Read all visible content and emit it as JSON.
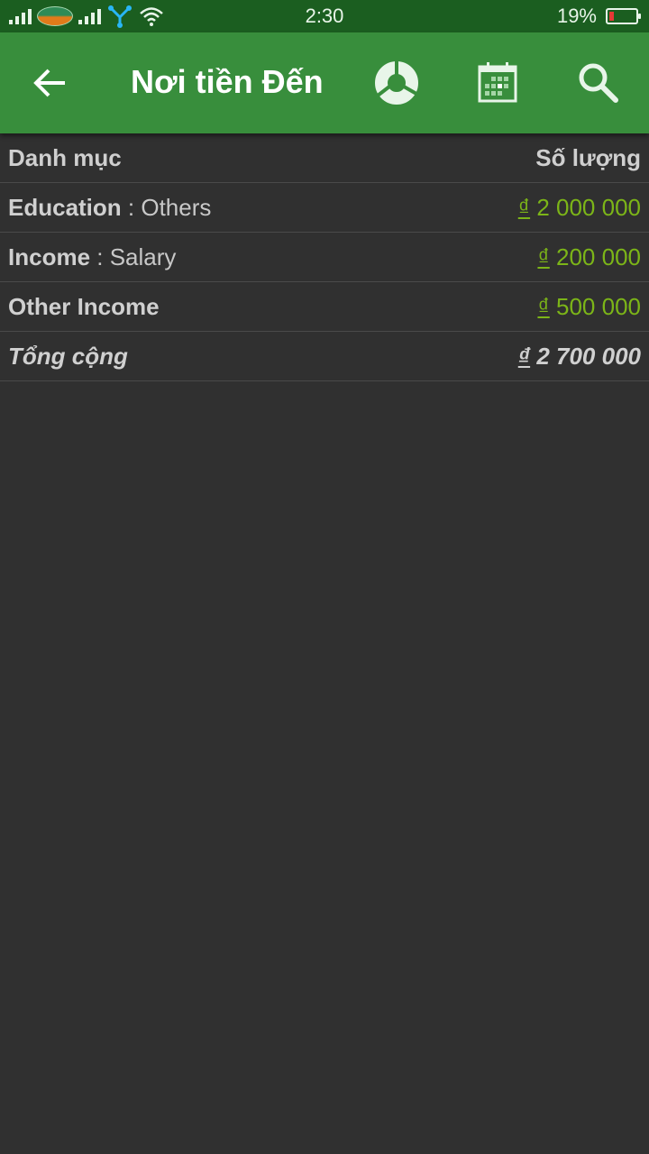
{
  "status_bar": {
    "time": "2:30",
    "battery_percent": "19%",
    "battery_level": 0.19,
    "icons": [
      "signal-icon",
      "carrier-logo",
      "signal-icon",
      "network-share-icon",
      "wifi-icon",
      "battery-icon"
    ]
  },
  "app_bar": {
    "title": "Nơi tiền Đến",
    "back_icon": "arrow-left-icon",
    "actions": [
      "donut-chart-icon",
      "calendar-icon",
      "search-icon"
    ],
    "color": "#388e3c"
  },
  "table": {
    "headers": {
      "category": "Danh mục",
      "amount": "Số lượng"
    },
    "rows": [
      {
        "category": "Education",
        "separator": " : ",
        "subcategory": "Others",
        "currency": "₫",
        "amount": " 2 000 000"
      },
      {
        "category": "Income",
        "separator": " : ",
        "subcategory": "Salary",
        "currency": "₫",
        "amount": " 200 000"
      },
      {
        "category": "Other Income",
        "separator": "",
        "subcategory": "",
        "currency": "₫",
        "amount": " 500 000"
      }
    ],
    "total": {
      "label": "Tổng cộng",
      "currency": "₫",
      "amount": " 2 700 000"
    },
    "amount_color": "#7cb518"
  }
}
